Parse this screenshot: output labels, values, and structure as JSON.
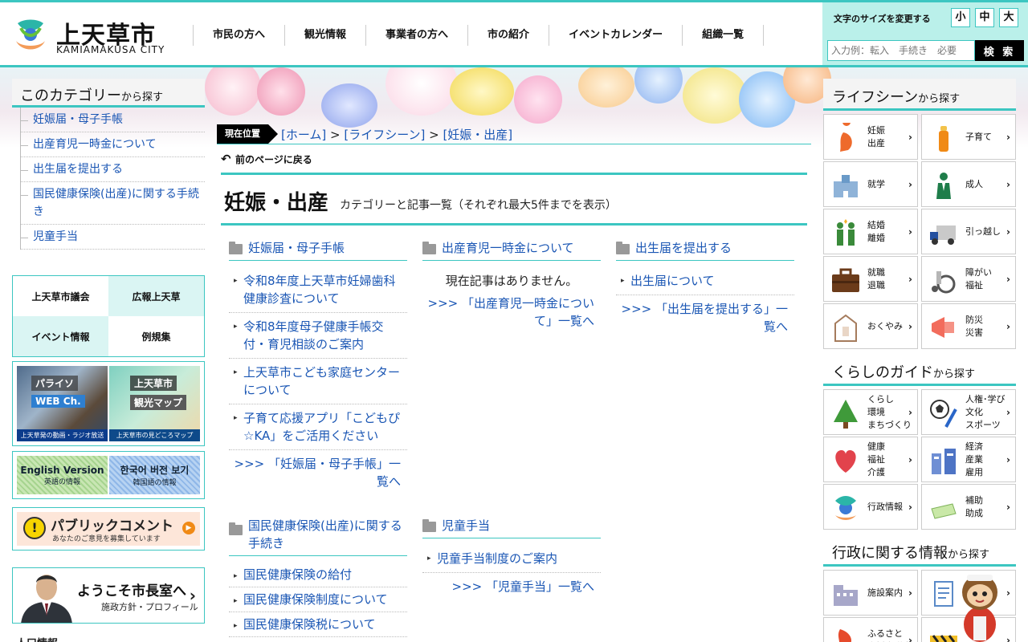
{
  "header": {
    "logo_title": "上天草市",
    "logo_sub": "KAMIAMAKUSA CITY",
    "nav": [
      "市民の方へ",
      "観光情報",
      "事業者の方へ",
      "市の紹介",
      "イベントカレンダー",
      "組織一覧"
    ],
    "font_size_label": "文字のサイズを変更する",
    "font_sizes": [
      "小",
      "中",
      "大"
    ],
    "search_placeholder": "入力例：転入　手続き　必要",
    "search_button": "検 索"
  },
  "left": {
    "heading_main": "このカテゴリー",
    "heading_suffix": "から探す",
    "categories": [
      "妊娠届・母子手帳",
      "出産育児一時金について",
      "出生届を提出する",
      "国民健康保険(出産)に関する手続き",
      "児童手当"
    ],
    "banners": [
      "上天草市議会",
      "広報上天草",
      "イベント情報",
      "例規集"
    ],
    "video_left_title": "パライソ",
    "video_left_sub": "WEB Ch.",
    "video_left_caption": "上天草発の動画・ラジオ放送",
    "video_right_title": "上天草市",
    "video_right_sub": "観光マップ",
    "video_right_caption": "上天草市の見どころマップ",
    "lang_en_main": "English Version",
    "lang_en_sub": "英語の情報",
    "lang_ko_main": "한국어 버전 보기",
    "lang_ko_sub": "韓国語の情報",
    "public_icon": "!",
    "public_title": "パブリックコメント",
    "public_sub": "あなたのご意見を募集しています",
    "mayor_title": "ようこそ市長室へ",
    "mayor_sub": "施政方針・プロフィール",
    "population_title": "人口情報"
  },
  "main": {
    "breadcrumb_label": "現在位置",
    "breadcrumb": [
      "[ホーム]",
      "[ライフシーン]",
      "[妊娠・出産]"
    ],
    "breadcrumb_sep": " > ",
    "back": "前のページに戻る",
    "title": "妊娠・出産",
    "subtitle": "カテゴリーと記事一覧（それぞれ最大5件までを表示）",
    "columns": [
      {
        "head": "妊娠届・母子手帳",
        "articles": [
          "令和8年度上天草市妊婦歯科健康診査について",
          "令和8年度母子健康手帳交付・育児相談のご案内",
          "上天草市こども家庭センターについて",
          "子育て応援アプリ「こどもぴ☆KA」をご活用ください"
        ],
        "more": ">>> 「妊娠届・母子手帳」一覧へ"
      },
      {
        "head": "出産育児一時金について",
        "articles": [],
        "empty": "現在記事はありません。",
        "more": ">>> 「出産育児一時金について」一覧へ"
      },
      {
        "head": "出生届を提出する",
        "articles": [
          "出生届について"
        ],
        "more": ">>> 「出生届を提出する」一覧へ"
      },
      {
        "head": "国民健康保険(出産)に関する手続き",
        "articles": [
          "国民健康保険の給付",
          "国民健康保険制度について",
          "国民健康保険税について"
        ],
        "more": ""
      },
      {
        "head": "児童手当",
        "articles": [
          "児童手当制度のご案内"
        ],
        "more": ">>> 「児童手当」一覧へ"
      }
    ]
  },
  "right": {
    "life_main": "ライフシーン",
    "life_suffix": "から探す",
    "life": [
      {
        "label": "妊娠\n出産",
        "icon": "pregnancy-icon"
      },
      {
        "label": "子育て",
        "icon": "baby-bottle-icon"
      },
      {
        "label": "就学",
        "icon": "school-icon"
      },
      {
        "label": "成人",
        "icon": "adult-icon"
      },
      {
        "label": "結婚\n離婚",
        "icon": "couple-icon"
      },
      {
        "label": "引っ越し",
        "icon": "truck-icon"
      },
      {
        "label": "就職\n退職",
        "icon": "briefcase-icon"
      },
      {
        "label": "障がい\n福祉",
        "icon": "wheelchair-icon"
      },
      {
        "label": "おくやみ",
        "icon": "condolence-icon"
      },
      {
        "label": "防災\n災害",
        "icon": "megaphone-icon"
      }
    ],
    "guide_main": "くらしのガイド",
    "guide_suffix": "から探す",
    "guide": [
      {
        "label": "くらし\n環境\nまちづくり",
        "icon": "tree-icon"
      },
      {
        "label": "人権･学び\n文化\nスポーツ",
        "icon": "soccer-icon"
      },
      {
        "label": "健康\n福祉\n介護",
        "icon": "heart-icon"
      },
      {
        "label": "経済\n産業\n雇用",
        "icon": "buildings-icon"
      },
      {
        "label": "行政情報",
        "icon": "city-logo-icon"
      },
      {
        "label": "補助\n助成",
        "icon": "subsidy-icon"
      }
    ],
    "admin_main": "行政に関する情報",
    "admin_suffix": "から探す",
    "admin": [
      {
        "label": "施設案内",
        "icon": "facility-icon"
      },
      {
        "label": "申請書",
        "icon": "document-icon"
      },
      {
        "label": "ふるさと\n応援寄附金",
        "icon": "hometown-icon"
      },
      {
        "label": "",
        "icon": "barrier-icon"
      }
    ]
  },
  "colors": {
    "accent": "#3cc6c1",
    "link": "#1a56b4",
    "tool_bg": "#baf0ea"
  }
}
